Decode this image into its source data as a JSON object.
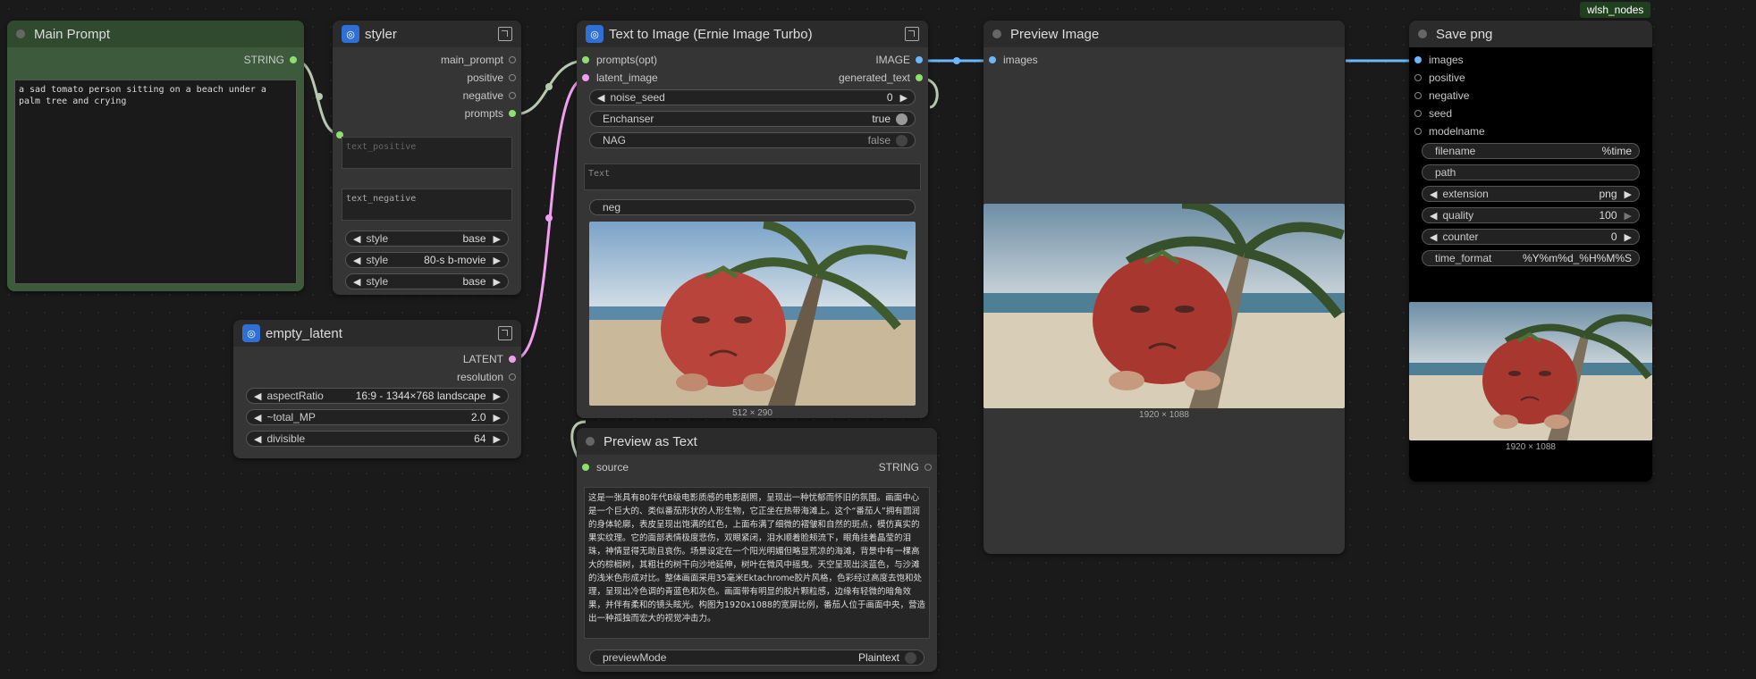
{
  "tag": "wlsh_nodes",
  "main_prompt": {
    "title": "Main Prompt",
    "out": "STRING",
    "text": "a sad tomato person sitting on a beach under a palm tree and crying"
  },
  "styler": {
    "title": "styler",
    "outputs": [
      "main_prompt",
      "positive",
      "negative",
      "prompts"
    ],
    "text_positive": "text_positive",
    "text_negative": "text_negative",
    "widgets": [
      {
        "label": "style",
        "value": "base"
      },
      {
        "label": "style",
        "value": "80-s b-movie"
      },
      {
        "label": "style",
        "value": "base"
      }
    ]
  },
  "empty_latent": {
    "title": "empty_latent",
    "outputs": [
      "LATENT",
      "resolution"
    ],
    "widgets": [
      {
        "label": "aspectRatio",
        "value": "16:9 - 1344×768 landscape"
      },
      {
        "label": "~total_MP",
        "value": "2.0"
      },
      {
        "label": "divisible",
        "value": "64"
      }
    ]
  },
  "t2i": {
    "title": "Text to Image (Ernie Image Turbo)",
    "in1": "prompts(opt)",
    "in2": "latent_image",
    "out1": "IMAGE",
    "out2": "generated_text",
    "noise_seed_label": "noise_seed",
    "noise_seed_value": "0",
    "enchanser_label": "Enchanser",
    "enchanser_value": "true",
    "nag_label": "NAG",
    "nag_value": "false",
    "text_placeholder": "Text",
    "neg_label": "neg",
    "dims": "512 × 290"
  },
  "preview_text": {
    "title": "Preview as Text",
    "in": "source",
    "out": "STRING",
    "text": "这是一张具有80年代B级电影质感的电影剧照，呈现出一种忧郁而怀旧的氛围。画面中心是一个巨大的、类似番茄形状的人形生物，它正坐在热带海滩上。这个“番茄人”拥有圆润的身体轮廓，表皮呈现出饱满的红色，上面布满了细微的褶皱和自然的斑点，模仿真实的果实纹理。它的面部表情极度悲伤，双眼紧闭，泪水顺着脸颊流下，眼角挂着晶莹的泪珠，神情显得无助且哀伤。场景设定在一个阳光明媚但略显荒凉的海滩，背景中有一棵高大的棕榈树，其粗壮的树干向沙地延伸，树叶在微风中摇曳。天空呈现出淡蓝色，与沙滩的浅米色形成对比。整体画面采用35毫米Ektachrome胶片风格，色彩经过高度去饱和处理，呈现出冷色调的青蓝色和灰色。画面带有明显的胶片颗粒感，边缘有轻微的暗角效果，并伴有柔和的镜头眩光。构图为1920x1088的宽屏比例，番茄人位于画面中央，营造出一种孤独而宏大的视觉冲击力。",
    "mode_label": "previewMode",
    "mode_value": "Plaintext"
  },
  "preview_image": {
    "title": "Preview Image",
    "in": "images",
    "dims": "1920 × 1088"
  },
  "save_png": {
    "title": "Save png",
    "inputs": [
      "images",
      "positive",
      "negative",
      "seed",
      "modelname"
    ],
    "widgets": [
      {
        "label": "filename",
        "value": "%time"
      },
      {
        "label": "path",
        "value": ""
      },
      {
        "label": "extension",
        "value": "png"
      },
      {
        "label": "quality",
        "value": "100"
      },
      {
        "label": "counter",
        "value": "0"
      },
      {
        "label": "time_format",
        "value": "%Y%m%d_%H%M%S"
      }
    ],
    "dims": "1920 × 1088"
  },
  "colors": {
    "string": "#8de06e",
    "latent": "#f09ff0",
    "image": "#6bb6ff",
    "group": "#3d5a3d"
  }
}
